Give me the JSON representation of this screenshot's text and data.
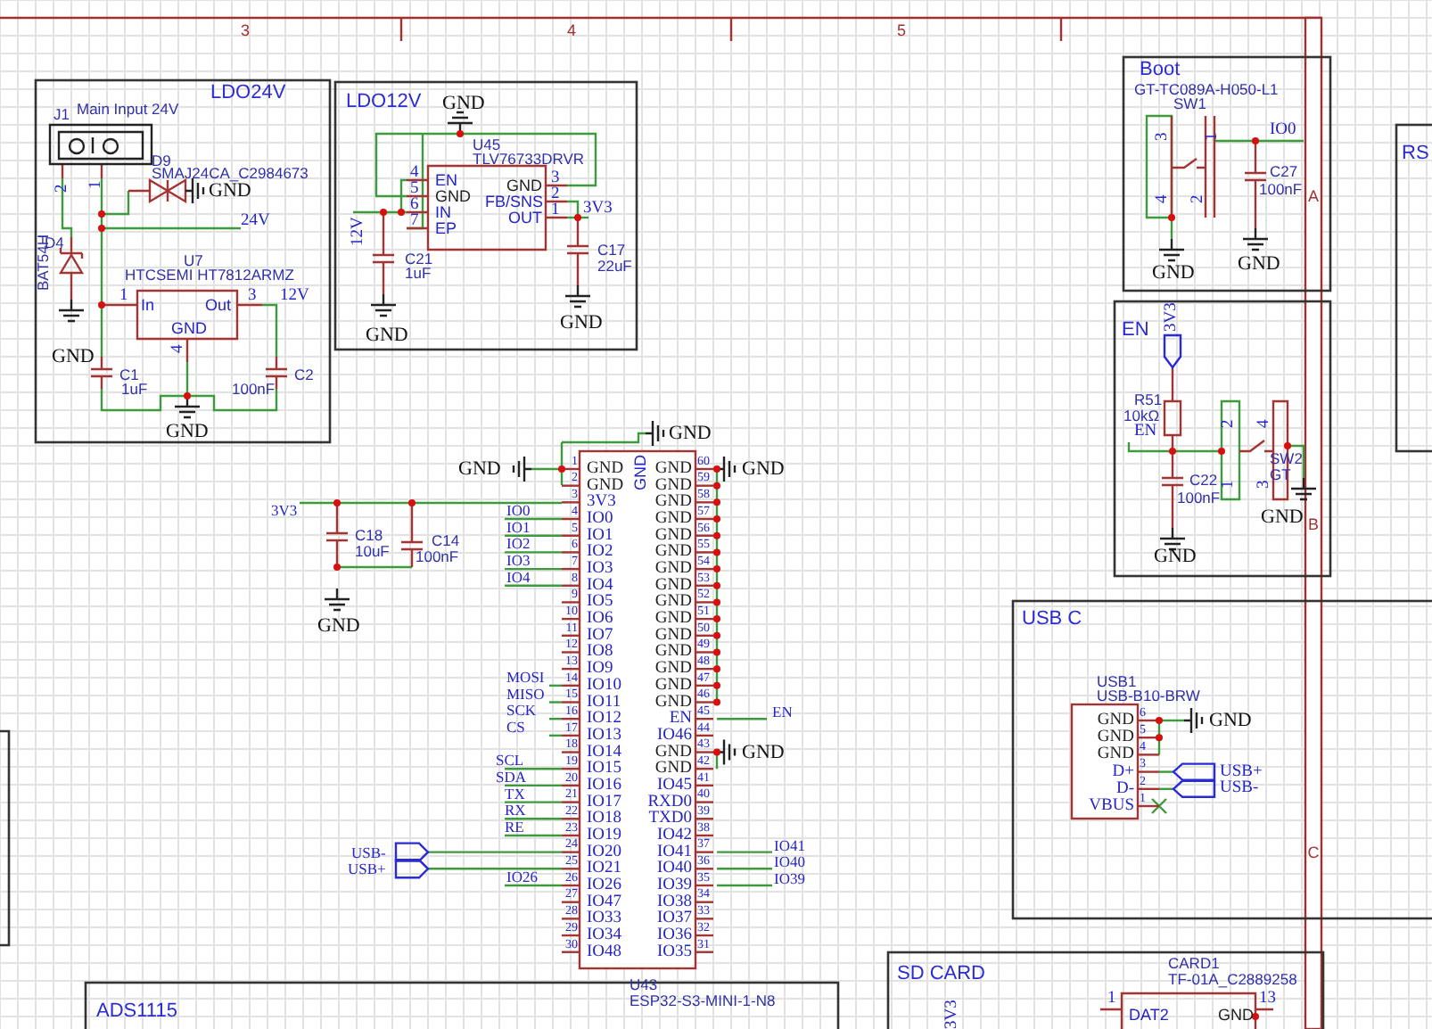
{
  "frame": {
    "columns": [
      "3",
      "4",
      "5"
    ],
    "rows": [
      "A",
      "B",
      "C"
    ]
  },
  "blocks": [
    {
      "title": "LDO24V",
      "labels": [
        {
          "kind": "ref",
          "text": "J1"
        },
        {
          "kind": "value",
          "text": "Main Input 24V"
        },
        {
          "kind": "pin",
          "text": "2"
        },
        {
          "kind": "pin",
          "text": "1"
        },
        {
          "kind": "ref",
          "text": "D9"
        },
        {
          "kind": "value",
          "text": "SMAJ24CA_C2984673"
        },
        {
          "kind": "gnd",
          "text": "GND"
        },
        {
          "kind": "net",
          "text": "24V"
        },
        {
          "kind": "ref",
          "text": "D4"
        },
        {
          "kind": "value",
          "text": "BAT54H"
        },
        {
          "kind": "ref",
          "text": "U7"
        },
        {
          "kind": "value",
          "text": "HTCSEMI HT7812ARMZ"
        },
        {
          "kind": "pin",
          "text": "1"
        },
        {
          "kind": "pin_name",
          "text": "In"
        },
        {
          "kind": "pin_name",
          "text": "Out"
        },
        {
          "kind": "pin",
          "text": "3"
        },
        {
          "kind": "net",
          "text": "12V"
        },
        {
          "kind": "pin_name",
          "text": "GND"
        },
        {
          "kind": "pin",
          "text": "4"
        },
        {
          "kind": "gnd",
          "text": "GND"
        },
        {
          "kind": "ref",
          "text": "C1"
        },
        {
          "kind": "value",
          "text": "1uF"
        },
        {
          "kind": "value",
          "text": "100nF"
        },
        {
          "kind": "ref",
          "text": "C2"
        },
        {
          "kind": "gnd",
          "text": "GND"
        }
      ]
    },
    {
      "title": "LDO12V",
      "labels": [
        {
          "kind": "gnd",
          "text": "GND"
        },
        {
          "kind": "ref",
          "text": "U45"
        },
        {
          "kind": "value",
          "text": "TLV76733DRVR"
        },
        {
          "kind": "pin",
          "text": "4"
        },
        {
          "kind": "pin",
          "text": "5"
        },
        {
          "kind": "pin",
          "text": "6"
        },
        {
          "kind": "pin",
          "text": "7"
        },
        {
          "kind": "pin_name",
          "text": "EN"
        },
        {
          "kind": "power_pin",
          "text": "GND"
        },
        {
          "kind": "pin_name",
          "text": "IN"
        },
        {
          "kind": "pin_name",
          "text": "EP"
        },
        {
          "kind": "power_pin",
          "text": "GND"
        },
        {
          "kind": "pin_name",
          "text": "FB/SNS"
        },
        {
          "kind": "pin_name",
          "text": "OUT"
        },
        {
          "kind": "pin",
          "text": "3"
        },
        {
          "kind": "pin",
          "text": "2"
        },
        {
          "kind": "pin",
          "text": "1"
        },
        {
          "kind": "net",
          "text": "3V3"
        },
        {
          "kind": "net",
          "text": "12V"
        },
        {
          "kind": "ref",
          "text": "C21"
        },
        {
          "kind": "value",
          "text": "1uF"
        },
        {
          "kind": "ref",
          "text": "C17"
        },
        {
          "kind": "value",
          "text": "22uF"
        },
        {
          "kind": "gnd",
          "text": "GND"
        },
        {
          "kind": "gnd",
          "text": "GND"
        }
      ]
    },
    {
      "title": "Boot",
      "labels": [
        {
          "kind": "value",
          "text": "GT-TC089A-H050-L1"
        },
        {
          "kind": "ref",
          "text": "SW1"
        },
        {
          "kind": "pin",
          "text": "3"
        },
        {
          "kind": "pin",
          "text": "1"
        },
        {
          "kind": "pin",
          "text": "4"
        },
        {
          "kind": "pin",
          "text": "2"
        },
        {
          "kind": "net",
          "text": "IO0"
        },
        {
          "kind": "ref",
          "text": "C27"
        },
        {
          "kind": "value",
          "text": "100nF"
        },
        {
          "kind": "gnd",
          "text": "GND"
        },
        {
          "kind": "gnd",
          "text": "GND"
        }
      ]
    },
    {
      "title": "EN",
      "labels": [
        {
          "kind": "net",
          "text": "3V3"
        },
        {
          "kind": "ref",
          "text": "R51"
        },
        {
          "kind": "value",
          "text": "10kΩ"
        },
        {
          "kind": "net",
          "text": "EN"
        },
        {
          "kind": "pin",
          "text": "2"
        },
        {
          "kind": "pin",
          "text": "1"
        },
        {
          "kind": "pin",
          "text": "4"
        },
        {
          "kind": "pin",
          "text": "3"
        },
        {
          "kind": "ref",
          "text": "SW2"
        },
        {
          "kind": "value",
          "text": "GT"
        },
        {
          "kind": "ref",
          "text": "C22"
        },
        {
          "kind": "value",
          "text": "100nF"
        },
        {
          "kind": "gnd",
          "text": "GND"
        },
        {
          "kind": "gnd",
          "text": "GND"
        }
      ]
    },
    {
      "title": "RS"
    },
    {
      "labels": [
        {
          "kind": "net",
          "text": "3V3"
        },
        {
          "kind": "ref",
          "text": "C18"
        },
        {
          "kind": "value",
          "text": "10uF"
        },
        {
          "kind": "ref",
          "text": "C14"
        },
        {
          "kind": "value",
          "text": "100nF"
        },
        {
          "kind": "gnd",
          "text": "GND"
        },
        {
          "kind": "gnd",
          "text": "GND"
        },
        {
          "kind": "net",
          "text": "IO0"
        },
        {
          "kind": "net",
          "text": "IO1"
        },
        {
          "kind": "net",
          "text": "IO2"
        },
        {
          "kind": "net",
          "text": "IO3"
        },
        {
          "kind": "net",
          "text": "IO4"
        },
        {
          "kind": "net",
          "text": "MOSI"
        },
        {
          "kind": "net",
          "text": "MISO"
        },
        {
          "kind": "net",
          "text": "SCK"
        },
        {
          "kind": "net",
          "text": "CS"
        },
        {
          "kind": "net",
          "text": "SCL"
        },
        {
          "kind": "net",
          "text": "SDA"
        },
        {
          "kind": "net",
          "text": "TX"
        },
        {
          "kind": "net",
          "text": "RX"
        },
        {
          "kind": "net",
          "text": "RE"
        },
        {
          "kind": "net",
          "text": "USB-"
        },
        {
          "kind": "net",
          "text": "USB+"
        },
        {
          "kind": "net",
          "text": "IO26"
        },
        {
          "kind": "gnd",
          "text": "GND"
        },
        {
          "kind": "gnd",
          "text": "GND"
        },
        {
          "kind": "net",
          "text": "EN"
        },
        {
          "kind": "gnd",
          "text": "GND"
        },
        {
          "kind": "net",
          "text": "IO41"
        },
        {
          "kind": "net",
          "text": "IO40"
        },
        {
          "kind": "net",
          "text": "IO39"
        },
        {
          "kind": "ref",
          "text": "U43"
        },
        {
          "kind": "value",
          "text": "ESP32-S3-MINI-1-N8"
        },
        {
          "kind": "pin_name",
          "text": "GND"
        }
      ],
      "chip": {
        "left_pins": [
          {
            "number": "1",
            "name": "GND",
            "power": true
          },
          {
            "number": "2",
            "name": "GND",
            "power": true
          },
          {
            "number": "3",
            "name": "3V3",
            "power": false
          },
          {
            "number": "4",
            "name": "IO0",
            "power": false
          },
          {
            "number": "5",
            "name": "IO1",
            "power": false
          },
          {
            "number": "6",
            "name": "IO2",
            "power": false
          },
          {
            "number": "7",
            "name": "IO3",
            "power": false
          },
          {
            "number": "8",
            "name": "IO4",
            "power": false
          },
          {
            "number": "9",
            "name": "IO5",
            "power": false
          },
          {
            "number": "10",
            "name": "IO6",
            "power": false
          },
          {
            "number": "11",
            "name": "IO7",
            "power": false
          },
          {
            "number": "12",
            "name": "IO8",
            "power": false
          },
          {
            "number": "13",
            "name": "IO9",
            "power": false
          },
          {
            "number": "14",
            "name": "IO10",
            "power": false
          },
          {
            "number": "15",
            "name": "IO11",
            "power": false
          },
          {
            "number": "16",
            "name": "IO12",
            "power": false
          },
          {
            "number": "17",
            "name": "IO13",
            "power": false
          },
          {
            "number": "18",
            "name": "IO14",
            "power": false
          },
          {
            "number": "19",
            "name": "IO15",
            "power": false
          },
          {
            "number": "20",
            "name": "IO16",
            "power": false
          },
          {
            "number": "21",
            "name": "IO17",
            "power": false
          },
          {
            "number": "22",
            "name": "IO18",
            "power": false
          },
          {
            "number": "23",
            "name": "IO19",
            "power": false
          },
          {
            "number": "24",
            "name": "IO20",
            "power": false
          },
          {
            "number": "25",
            "name": "IO21",
            "power": false
          },
          {
            "number": "26",
            "name": "IO26",
            "power": false
          },
          {
            "number": "27",
            "name": "IO47",
            "power": false
          },
          {
            "number": "28",
            "name": "IO33",
            "power": false
          },
          {
            "number": "29",
            "name": "IO34",
            "power": false
          },
          {
            "number": "30",
            "name": "IO48",
            "power": false
          }
        ],
        "right_pins": [
          {
            "number": "60",
            "name": "GND",
            "power": true
          },
          {
            "number": "59",
            "name": "GND",
            "power": true
          },
          {
            "number": "58",
            "name": "GND",
            "power": true
          },
          {
            "number": "57",
            "name": "GND",
            "power": true
          },
          {
            "number": "56",
            "name": "GND",
            "power": true
          },
          {
            "number": "55",
            "name": "GND",
            "power": true
          },
          {
            "number": "54",
            "name": "GND",
            "power": true
          },
          {
            "number": "53",
            "name": "GND",
            "power": true
          },
          {
            "number": "52",
            "name": "GND",
            "power": true
          },
          {
            "number": "51",
            "name": "GND",
            "power": true
          },
          {
            "number": "50",
            "name": "GND",
            "power": true
          },
          {
            "number": "49",
            "name": "GND",
            "power": true
          },
          {
            "number": "48",
            "name": "GND",
            "power": true
          },
          {
            "number": "47",
            "name": "GND",
            "power": true
          },
          {
            "number": "46",
            "name": "GND",
            "power": true
          },
          {
            "number": "45",
            "name": "EN",
            "power": false
          },
          {
            "number": "44",
            "name": "IO46",
            "power": false
          },
          {
            "number": "43",
            "name": "GND",
            "power": true
          },
          {
            "number": "42",
            "name": "GND",
            "power": true
          },
          {
            "number": "41",
            "name": "IO45",
            "power": false
          },
          {
            "number": "40",
            "name": "RXD0",
            "power": false
          },
          {
            "number": "39",
            "name": "TXD0",
            "power": false
          },
          {
            "number": "38",
            "name": "IO42",
            "power": false
          },
          {
            "number": "37",
            "name": "IO41",
            "power": false
          },
          {
            "number": "36",
            "name": "IO40",
            "power": false
          },
          {
            "number": "35",
            "name": "IO39",
            "power": false
          },
          {
            "number": "34",
            "name": "IO38",
            "power": false
          },
          {
            "number": "33",
            "name": "IO37",
            "power": false
          },
          {
            "number": "32",
            "name": "IO36",
            "power": false
          },
          {
            "number": "31",
            "name": "IO35",
            "power": false
          }
        ]
      }
    },
    {
      "title": "USB C",
      "labels": [
        {
          "kind": "ref",
          "text": "USB1"
        },
        {
          "kind": "value",
          "text": "USB-B10-BRW"
        },
        {
          "kind": "gnd",
          "text": "GND"
        },
        {
          "kind": "net",
          "text": "USB+"
        },
        {
          "kind": "net",
          "text": "USB-"
        }
      ],
      "chip": {
        "right_pins": [
          {
            "number": "6",
            "name": "GND",
            "power": true
          },
          {
            "number": "5",
            "name": "GND",
            "power": true
          },
          {
            "number": "4",
            "name": "GND",
            "power": true
          },
          {
            "number": "3",
            "name": "D+",
            "power": false
          },
          {
            "number": "2",
            "name": "D-",
            "power": false
          },
          {
            "number": "1",
            "name": "VBUS",
            "power": false
          }
        ]
      }
    },
    {
      "title": "SD CARD",
      "labels": [
        {
          "kind": "ref",
          "text": "CARD1"
        },
        {
          "kind": "value",
          "text": "TF-01A_C2889258"
        },
        {
          "kind": "pin",
          "text": "1"
        },
        {
          "kind": "pin_name",
          "text": "DAT2"
        },
        {
          "kind": "power_pin",
          "text": "GND"
        },
        {
          "kind": "pin",
          "text": "13"
        },
        {
          "kind": "net",
          "text": "3V3"
        }
      ]
    },
    {
      "title": "ADS1115"
    }
  ]
}
